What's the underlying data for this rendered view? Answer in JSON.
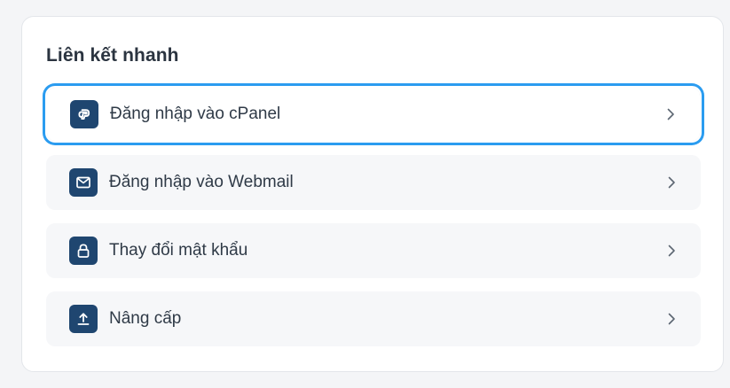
{
  "quick_links": {
    "title": "Liên kết nhanh",
    "items": [
      {
        "label": "Đăng nhập vào cPanel",
        "icon": "cpanel-icon",
        "focused": true
      },
      {
        "label": "Đăng nhập vào Webmail",
        "icon": "mail-icon",
        "focused": false
      },
      {
        "label": "Thay đổi mật khẩu",
        "icon": "lock-icon",
        "focused": false
      },
      {
        "label": "Nâng cấp",
        "icon": "upload-icon",
        "focused": false
      }
    ]
  },
  "colors": {
    "icon_background": "#1f4670",
    "focus_ring": "#2b9cf0",
    "card_background": "#ffffff",
    "item_background": "#f6f7f9"
  }
}
